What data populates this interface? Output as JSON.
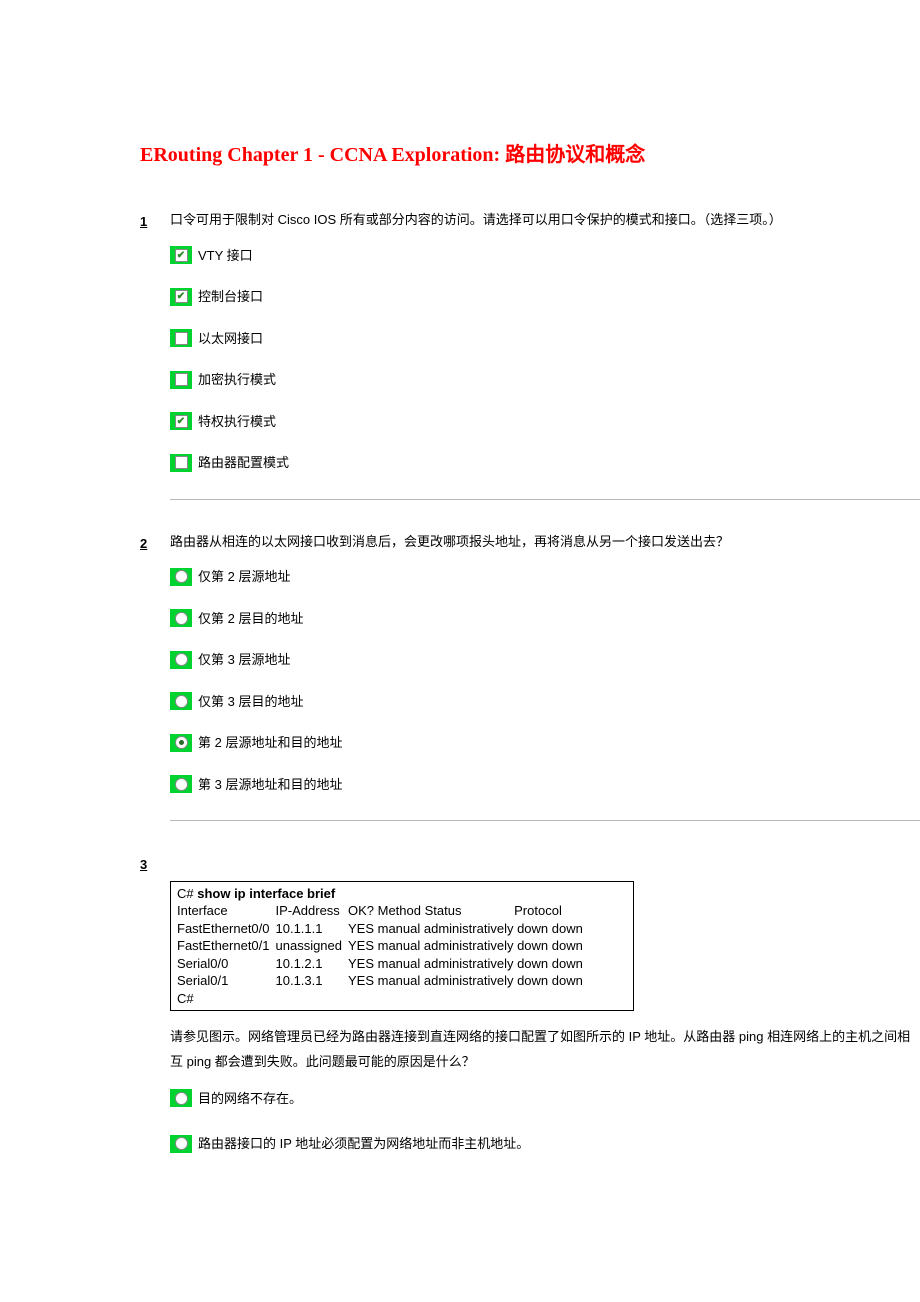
{
  "title": "ERouting Chapter 1 - CCNA Exploration: 路由协议和概念",
  "q1": {
    "num": "1",
    "text": "口令可用于限制对 Cisco IOS 所有或部分内容的访问。请选择可以用口令保护的模式和接口。（选择三项。）",
    "opts": [
      "VTY 接口",
      "控制台接口",
      "以太网接口",
      "加密执行模式",
      "特权执行模式",
      "路由器配置模式"
    ]
  },
  "q2": {
    "num": "2",
    "text": "路由器从相连的以太网接口收到消息后，会更改哪项报头地址，再将消息从另一个接口发送出去？",
    "opts": [
      "仅第 2 层源地址",
      "仅第 2 层目的地址",
      "仅第 3 层源地址",
      "仅第 3 层目的地址",
      "第 2 层源地址和目的地址",
      "第 3 层源地址和目的地址"
    ]
  },
  "q3": {
    "num": "3",
    "cli": {
      "cmd_prefix": "C# ",
      "cmd": "show ip interface brief",
      "h0": "Interface",
      "h1": "IP-Address",
      "h2": "OK? Method Status",
      "h3": "Protocol",
      "r0c0": "FastEthernet0/0",
      "r0c1": "10.1.1.1",
      "r0c2": "YES manual administratively down down",
      "r1c0": "FastEthernet0/1",
      "r1c1": "unassigned",
      "r1c2": "YES manual administratively down down",
      "r2c0": "Serial0/0",
      "r2c1": "10.1.2.1",
      "r2c2": "YES manual administratively down down",
      "r3c0": "Serial0/1",
      "r3c1": "10.1.3.1",
      "r3c2": "YES manual administratively down down",
      "prompt": "C#"
    },
    "text": "请参见图示。网络管理员已经为路由器连接到直连网络的接口配置了如图所示的 IP 地址。从路由器 ping 相连网络上的主机之间相互 ping 都会遭到失败。此问题最可能的原因是什么？",
    "opts": [
      "目的网络不存在。",
      "路由器接口的 IP 地址必须配置为网络地址而非主机地址。"
    ]
  }
}
